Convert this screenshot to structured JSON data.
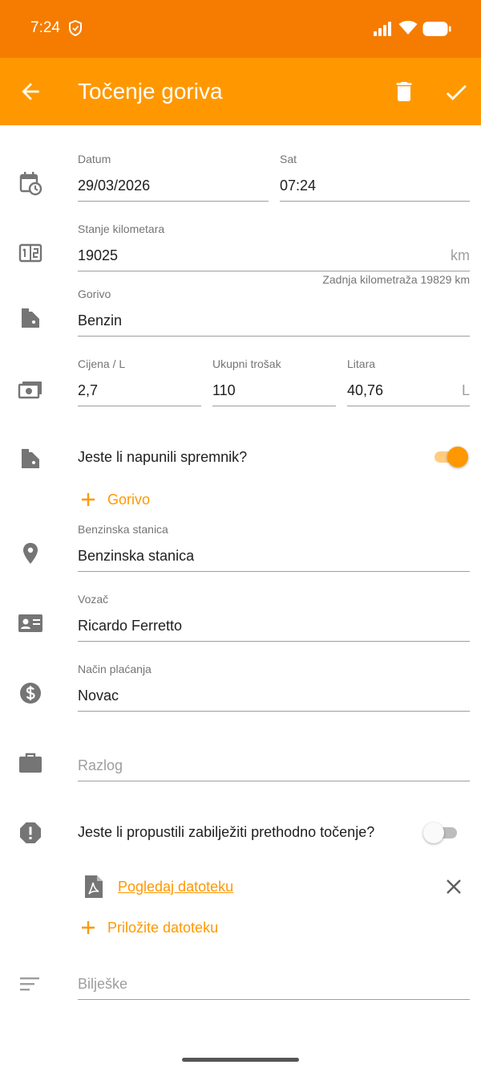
{
  "status_bar": {
    "time": "7:24"
  },
  "app_bar": {
    "title": "Točenje goriva"
  },
  "fields": {
    "date": {
      "label": "Datum",
      "value": "29/03/2026"
    },
    "time": {
      "label": "Sat",
      "value": "07:24"
    },
    "odometer": {
      "label": "Stanje kilometara",
      "value": "19025",
      "suffix": "km",
      "helper": "Zadnja kilometraža 19829 km"
    },
    "fuel": {
      "label": "Gorivo",
      "value": "Benzin"
    },
    "price": {
      "label": "Cijena / L",
      "value": "2,7"
    },
    "total": {
      "label": "Ukupni trošak",
      "value": "110"
    },
    "liters": {
      "label": "Litara",
      "value": "40,76",
      "suffix": "L"
    },
    "station": {
      "label": "Benzinska stanica",
      "value": "Benzinska stanica"
    },
    "driver": {
      "label": "Vozač",
      "value": "Ricardo Ferretto"
    },
    "payment": {
      "label": "Način plaćanja",
      "value": "Novac"
    },
    "reason": {
      "placeholder": "Razlog"
    },
    "notes": {
      "placeholder": "Bilješke"
    }
  },
  "full_tank": {
    "label": "Jeste li napunili spremnik?",
    "checked": true
  },
  "add_fuel": {
    "label": "Gorivo"
  },
  "missed_refuel": {
    "label": "Jeste li propustili zabilježiti prethodno točenje?",
    "checked": false
  },
  "attachment": {
    "link_label": "Pogledaj datoteku"
  },
  "attach_file": {
    "label": "Priložite datoteku"
  },
  "colors": {
    "primary": "#ff9800",
    "status_bar": "#f57c00",
    "icon_gray": "#757575"
  }
}
